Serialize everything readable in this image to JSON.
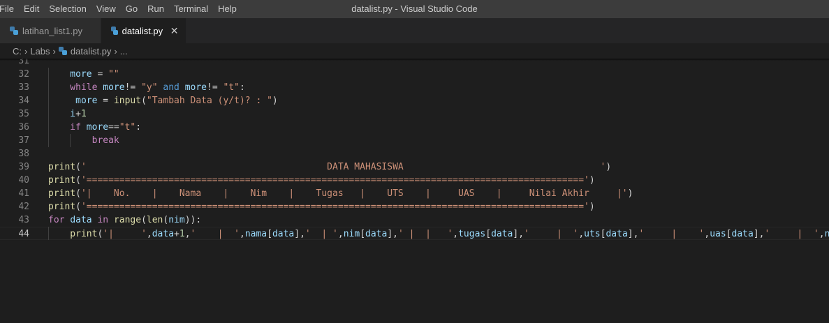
{
  "window": {
    "title": "datalist.py - Visual Studio Code"
  },
  "menu": [
    "File",
    "Edit",
    "Selection",
    "View",
    "Go",
    "Run",
    "Terminal",
    "Help"
  ],
  "tabs": [
    {
      "label": "latihan_list1.py",
      "active": false
    },
    {
      "label": "datalist.py",
      "active": true,
      "close": "✕"
    }
  ],
  "breadcrumb": {
    "root": "C:",
    "folder": "Labs",
    "file": "datalist.py",
    "symbol": "..."
  },
  "editor": {
    "current_line": "44",
    "lines": [
      {
        "n": "31",
        "code": []
      },
      {
        "n": "32",
        "code": [
          [
            "var",
            "    more"
          ],
          [
            "op",
            " = "
          ],
          [
            "str",
            "\"\""
          ]
        ]
      },
      {
        "n": "33",
        "code": [
          [
            "kw",
            "    while "
          ],
          [
            "var",
            "more"
          ],
          [
            "op",
            "!= "
          ],
          [
            "str",
            "\"y\""
          ],
          [
            "kw2",
            " and "
          ],
          [
            "var",
            "more"
          ],
          [
            "op",
            "!= "
          ],
          [
            "str",
            "\"t\""
          ],
          [
            "op",
            ":"
          ]
        ]
      },
      {
        "n": "34",
        "code": [
          [
            "var",
            "     more"
          ],
          [
            "op",
            " = "
          ],
          [
            "fn",
            "input"
          ],
          [
            "op",
            "("
          ],
          [
            "str",
            "\"Tambah Data (y/t)? : \""
          ],
          [
            "op",
            ")"
          ]
        ]
      },
      {
        "n": "35",
        "code": [
          [
            "var",
            "    i"
          ],
          [
            "op",
            "+"
          ],
          [
            "num",
            "1"
          ]
        ]
      },
      {
        "n": "36",
        "code": [
          [
            "kw",
            "    if "
          ],
          [
            "var",
            "more"
          ],
          [
            "op",
            "=="
          ],
          [
            "str",
            "\"t\""
          ],
          [
            "op",
            ":"
          ]
        ]
      },
      {
        "n": "37",
        "code": [
          [
            "kw",
            "        break"
          ]
        ]
      },
      {
        "n": "38",
        "code": []
      },
      {
        "n": "39",
        "code": [
          [
            "fn",
            "print"
          ],
          [
            "op",
            "("
          ],
          [
            "str",
            "'                                            DATA MAHASISWA                                    '"
          ],
          [
            "op",
            ")"
          ]
        ]
      },
      {
        "n": "40",
        "code": [
          [
            "fn",
            "print"
          ],
          [
            "op",
            "("
          ],
          [
            "str",
            "'==========================================================================================='"
          ],
          [
            "op",
            ")"
          ]
        ]
      },
      {
        "n": "41",
        "code": [
          [
            "fn",
            "print"
          ],
          [
            "op",
            "("
          ],
          [
            "str",
            "'|    No.    |    Nama    |    Nim    |    Tugas   |    UTS    |     UAS    |     Nilai Akhir     |'"
          ],
          [
            "op",
            ")"
          ]
        ]
      },
      {
        "n": "42",
        "code": [
          [
            "fn",
            "print"
          ],
          [
            "op",
            "("
          ],
          [
            "str",
            "'==========================================================================================='"
          ],
          [
            "op",
            ")"
          ]
        ]
      },
      {
        "n": "43",
        "code": [
          [
            "kw",
            "for "
          ],
          [
            "var",
            "data"
          ],
          [
            "kw",
            " in "
          ],
          [
            "fn",
            "range"
          ],
          [
            "op",
            "("
          ],
          [
            "fn",
            "len"
          ],
          [
            "op",
            "("
          ],
          [
            "var",
            "nim"
          ],
          [
            "op",
            "))"
          ],
          [
            "op",
            ":"
          ]
        ]
      },
      {
        "n": "44",
        "code": [
          [
            "fn",
            "    print"
          ],
          [
            "op",
            "("
          ],
          [
            "str",
            "'|     '"
          ],
          [
            "op",
            ","
          ],
          [
            "var",
            "data"
          ],
          [
            "op",
            "+"
          ],
          [
            "num",
            "1"
          ],
          [
            "op",
            ","
          ],
          [
            "str",
            "'    |  '"
          ],
          [
            "op",
            ","
          ],
          [
            "var",
            "nama"
          ],
          [
            "op",
            "["
          ],
          [
            "var",
            "data"
          ],
          [
            "op",
            "],"
          ],
          [
            "str",
            "'  | '"
          ],
          [
            "op",
            ","
          ],
          [
            "var",
            "nim"
          ],
          [
            "op",
            "["
          ],
          [
            "var",
            "data"
          ],
          [
            "op",
            "],"
          ],
          [
            "str",
            "' |  |   '"
          ],
          [
            "op",
            ","
          ],
          [
            "var",
            "tugas"
          ],
          [
            "op",
            "["
          ],
          [
            "var",
            "data"
          ],
          [
            "op",
            "],"
          ],
          [
            "str",
            "'     |  '"
          ],
          [
            "op",
            ","
          ],
          [
            "var",
            "uts"
          ],
          [
            "op",
            "["
          ],
          [
            "var",
            "data"
          ],
          [
            "op",
            "],"
          ],
          [
            "str",
            "'     |    '"
          ],
          [
            "op",
            ","
          ],
          [
            "var",
            "uas"
          ],
          [
            "op",
            "["
          ],
          [
            "var",
            "data"
          ],
          [
            "op",
            "],"
          ],
          [
            "str",
            "'     |  '"
          ],
          [
            "op",
            ","
          ],
          [
            "var",
            "nilaiakhir"
          ]
        ]
      }
    ]
  }
}
